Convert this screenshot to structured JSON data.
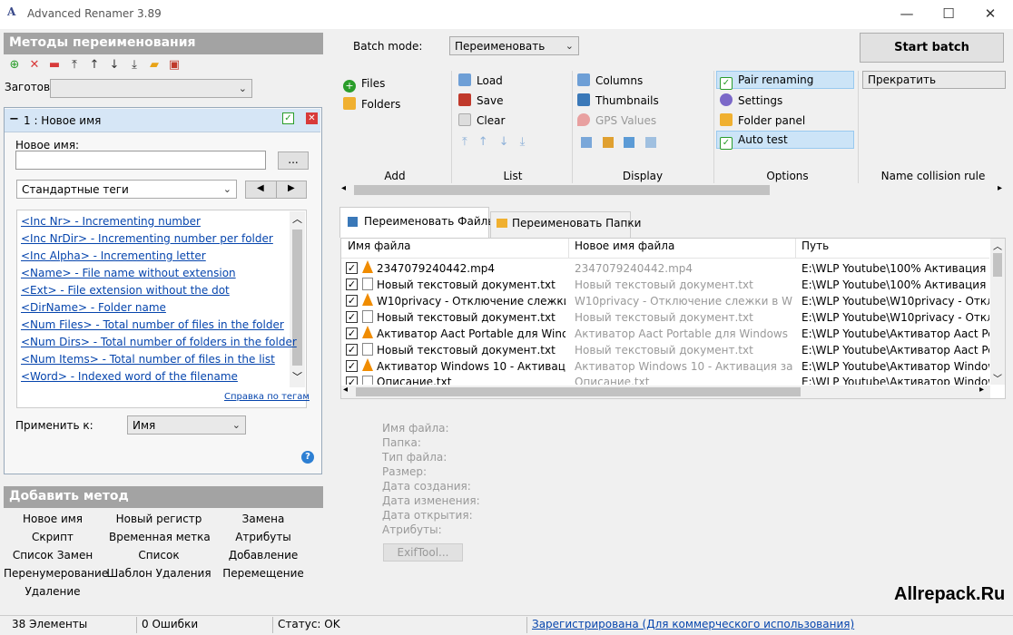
{
  "window": {
    "title": "Advanced Renamer 3.89",
    "icon_text": "A",
    "controls": {
      "minimize": "—",
      "maximize": "☐",
      "close": "✕"
    }
  },
  "left": {
    "methods_header": "Методы переименования",
    "preset_label": "Заготовки",
    "method_item": {
      "collapse": "−",
      "title": "1 : Новое имя",
      "new_name_label": "Новое имя:",
      "new_name_value": "",
      "browse_label": "...",
      "tags_dropdown": "Стандартные теги",
      "tags": [
        "<Inc Nr> - Incrementing number",
        "<Inc NrDir> - Incrementing number per folder",
        "<Inc Alpha> - Incrementing letter",
        "<Name> - File name without extension",
        "<Ext> - File extension without the dot",
        "<DirName> - Folder name",
        "<Num Files> - Total number of files in the folder",
        "<Num Dirs> - Total number of folders in the folder",
        "<Num Items> - Total number of files in the list",
        "<Word> - Indexed word of the filename"
      ],
      "tags_help": "Справка по тегам",
      "apply_to_label": "Применить к:",
      "apply_to_value": "Имя"
    },
    "add_method_header": "Добавить метод",
    "add_methods": [
      "Новое имя",
      "Новый регистр",
      "Замена",
      "Скрипт",
      "Временная метка",
      "Атрибуты",
      "Список Замен",
      "Список",
      "Добавление",
      "Перенумерование",
      "Шаблон Удаления",
      "Перемещение",
      "Удаление"
    ]
  },
  "toolbar": {
    "batch_mode_label": "Batch mode:",
    "batch_mode_value": "Переименовать",
    "start_batch": "Start batch",
    "add": {
      "files": "Files",
      "folders": "Folders",
      "label": "Add"
    },
    "list": {
      "load": "Load",
      "save": "Save",
      "clear": "Clear",
      "label": "List"
    },
    "display": {
      "columns": "Columns",
      "thumbnails": "Thumbnails",
      "gps": "GPS Values",
      "label": "Display"
    },
    "options": {
      "pair": "Pair renaming",
      "settings": "Settings",
      "folder_panel": "Folder panel",
      "auto_test": "Auto test",
      "label": "Options"
    },
    "collision": {
      "value": "Прекратить",
      "label": "Name collision rule"
    }
  },
  "tabs": [
    "Переименовать Файлы",
    "Переименовать Папки"
  ],
  "grid": {
    "columns": [
      "Имя файла",
      "Новое имя файла",
      "Путь"
    ],
    "rows": [
      {
        "icon": "vlc",
        "name": "2347079240442.mp4",
        "new": "2347079240442.mp4",
        "path": "E:\\WLP Youtube\\100% Активация W"
      },
      {
        "icon": "txt",
        "name": "Новый текстовый документ.txt",
        "new": "Новый текстовый документ.txt",
        "path": "E:\\WLP Youtube\\100% Активация W"
      },
      {
        "icon": "vlc",
        "name": "W10privacy - Отключение слежки...",
        "new": "W10privacy - Отключение слежки в Wi...",
        "path": "E:\\WLP Youtube\\W10privacy - Отклю"
      },
      {
        "icon": "txt",
        "name": "Новый текстовый документ.txt",
        "new": "Новый текстовый документ.txt",
        "path": "E:\\WLP Youtube\\W10privacy - Отклю"
      },
      {
        "icon": "vlc",
        "name": "Активатор Aact Portable для Wind...",
        "new": "Активатор Aact Portable для Windows ...",
        "path": "E:\\WLP Youtube\\Активатор Aact Por"
      },
      {
        "icon": "txt",
        "name": "Новый текстовый документ.txt",
        "new": "Новый текстовый документ.txt",
        "path": "E:\\WLP Youtube\\Активатор Aact Por"
      },
      {
        "icon": "vlc",
        "name": "Активатор Windows 10 - Активаци...",
        "new": "Активатор Windows 10 - Активация за ...",
        "path": "E:\\WLP Youtube\\Активатор Windows"
      },
      {
        "icon": "txt",
        "name": "Описание.txt",
        "new": "Описание.txt",
        "path": "E:\\WLP Youtube\\Активатор Windows"
      }
    ]
  },
  "properties": [
    "Имя файла:",
    "Папка:",
    "Тип файла:",
    "Размер:",
    "Дата создания:",
    "Дата изменения:",
    "Дата открытия:",
    "Атрибуты:"
  ],
  "exif_button": "ExifTool...",
  "watermark": "Allrepack.Ru",
  "status": {
    "items": "38 Элементы",
    "errors": "0 Ошибки",
    "state": "Статус: OK",
    "registered": "Зарегистрирована  (Для коммерческого использования)"
  }
}
